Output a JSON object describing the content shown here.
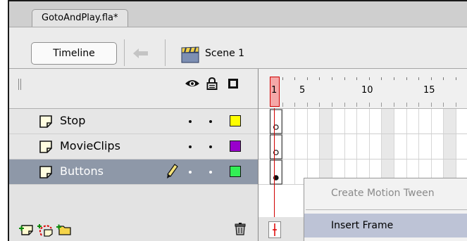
{
  "document": {
    "tab_title": "GotoAndPlay.fla*"
  },
  "edit_bar": {
    "timeline_button": "Timeline",
    "scene_label": "Scene 1",
    "back_icon": "back-arrow-icon",
    "scene_icon": "scene-clapper-icon"
  },
  "layers_header": {
    "icons": [
      "eye-icon",
      "lock-icon",
      "outline-icon"
    ]
  },
  "layers": [
    {
      "name": "Stop",
      "color": "#ffff00",
      "selected": false
    },
    {
      "name": "MovieClips",
      "color": "#9900cc",
      "selected": false
    },
    {
      "name": "Buttons",
      "color": "#33ee55",
      "selected": true
    }
  ],
  "layers_footer": {
    "icons": [
      "insert-layer-icon",
      "add-motion-guide-icon",
      "insert-layer-folder-icon",
      "delete-layer-icon"
    ]
  },
  "timeline": {
    "current_frame": "1",
    "ruler_labels": [
      "5",
      "10",
      "15"
    ]
  },
  "context_menu": {
    "items": [
      {
        "label": "Create Motion Tween",
        "enabled": false
      },
      {
        "label": "Insert Frame",
        "enabled": true,
        "highlighted": true
      }
    ]
  }
}
